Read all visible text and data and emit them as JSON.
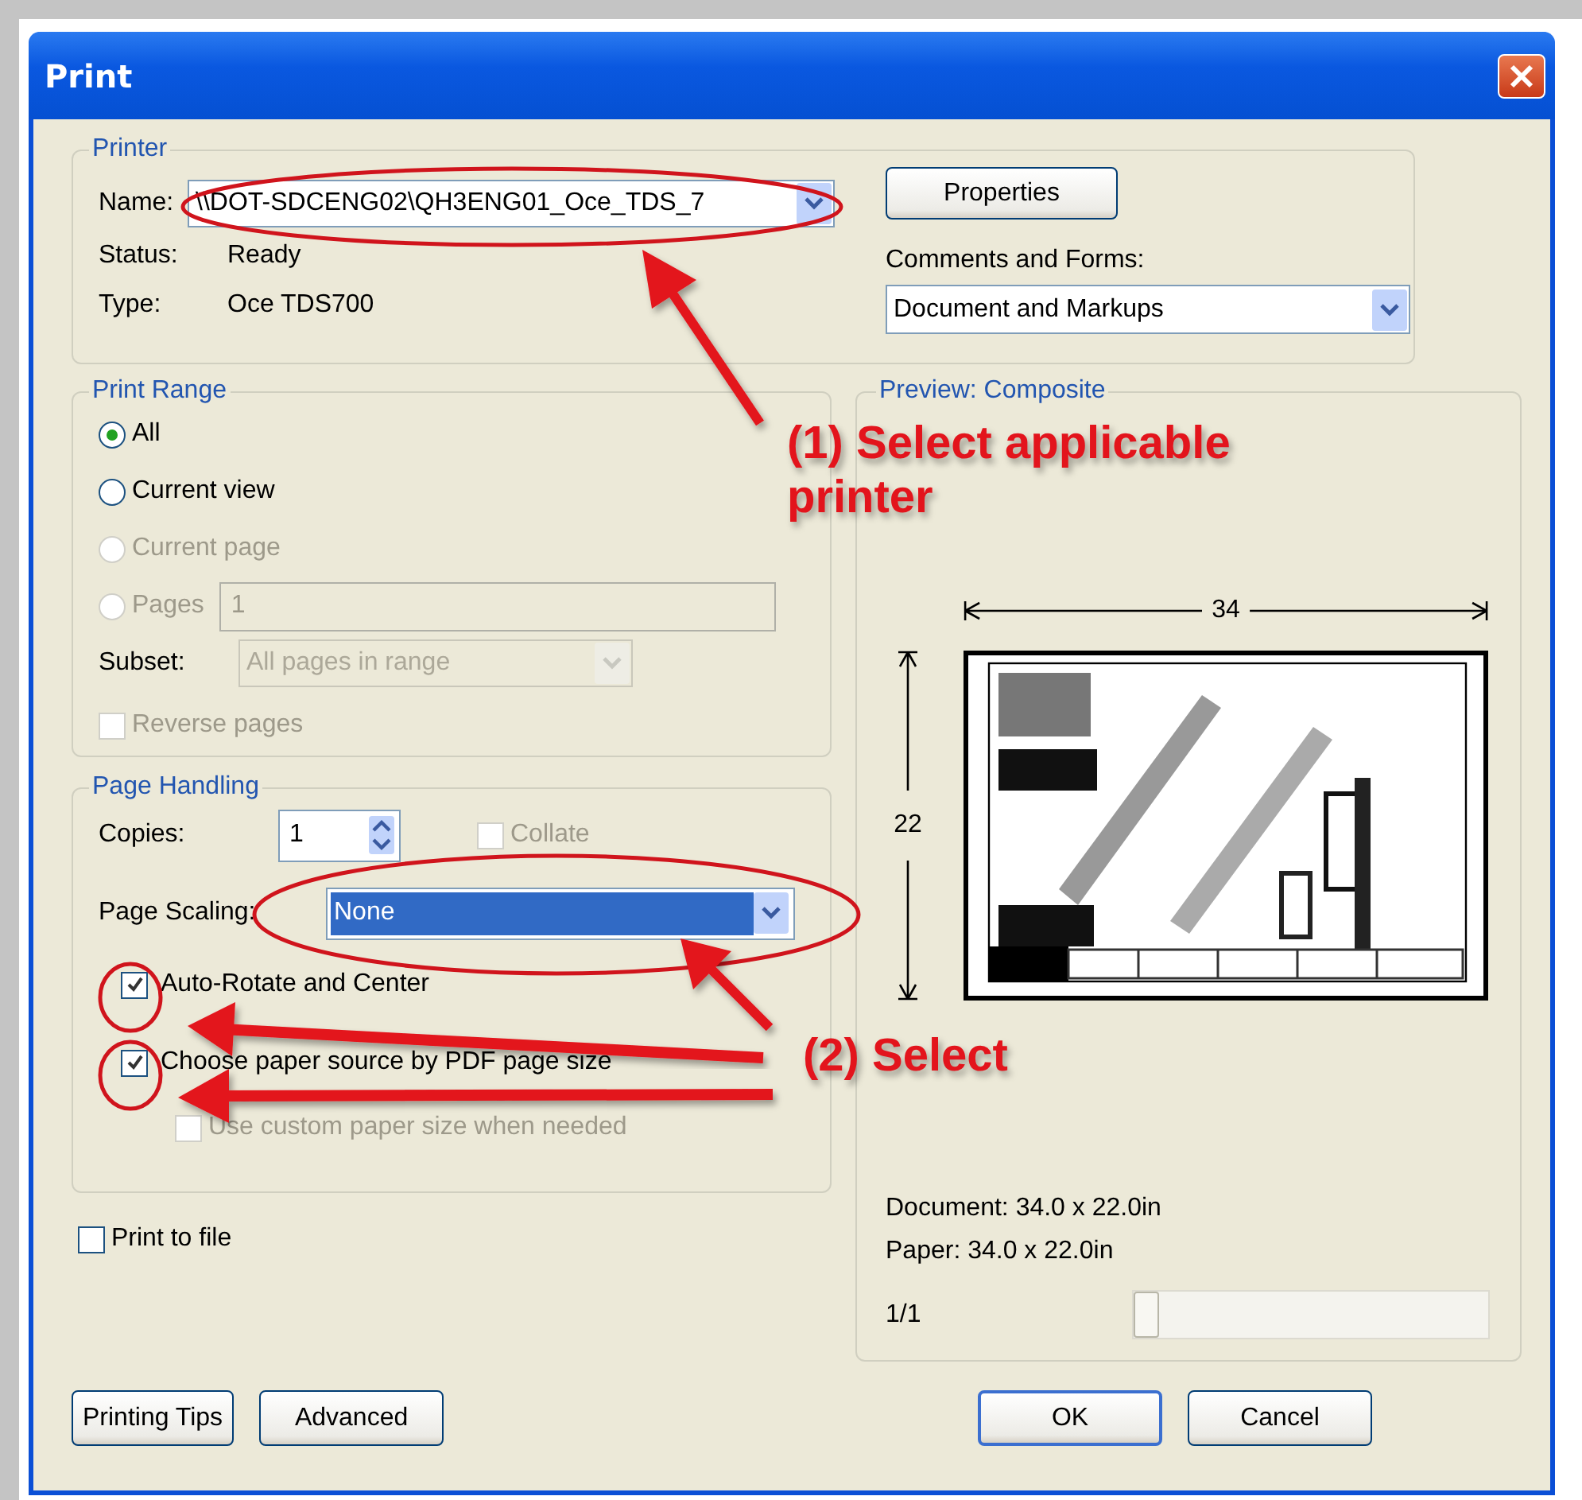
{
  "window": {
    "title": "Print"
  },
  "printer": {
    "title": "Printer",
    "name_label": "Name:",
    "name_value": "\\\\DOT-SDCENG02\\QH3ENG01_Oce_TDS_7",
    "properties_button": "Properties",
    "status_label": "Status:",
    "status_value": "Ready",
    "type_label": "Type:",
    "type_value": "Oce TDS700",
    "comments_label": "Comments and Forms:",
    "comments_value": "Document and Markups"
  },
  "print_range": {
    "title": "Print Range",
    "options": [
      {
        "label": "All",
        "selected": true,
        "disabled": false
      },
      {
        "label": "Current view",
        "selected": false,
        "disabled": false
      },
      {
        "label": "Current page",
        "selected": false,
        "disabled": true
      },
      {
        "label": "Pages",
        "selected": false,
        "disabled": true,
        "value": "1"
      }
    ],
    "subset_label": "Subset:",
    "subset_value": "All pages in range",
    "subset_disabled": true,
    "reverse_pages": {
      "label": "Reverse pages",
      "checked": false,
      "disabled": true
    }
  },
  "page_handling": {
    "title": "Page Handling",
    "copies_label": "Copies:",
    "copies_value": "1",
    "collate": {
      "label": "Collate",
      "checked": false,
      "disabled": true
    },
    "scaling_label": "Page Scaling:",
    "scaling_value": "None",
    "options": [
      {
        "label": "Auto-Rotate and Center",
        "checked": true,
        "disabled": false
      },
      {
        "label": "Choose paper source by PDF page size",
        "checked": true,
        "disabled": false,
        "children": [
          {
            "label": "Use custom paper size when needed",
            "checked": false,
            "disabled": true
          }
        ]
      }
    ]
  },
  "print_to_file": {
    "label": "Print to file",
    "checked": false
  },
  "preview": {
    "title": "Preview: Composite",
    "width_label": "34",
    "height_label": "22",
    "document": "Document: 34.0 x 22.0in",
    "paper": "Paper: 34.0 x 22.0in",
    "page": "1/1",
    "page_slider": {
      "level": 0
    }
  },
  "buttons_left": [
    "Printing Tips",
    "Advanced"
  ],
  "buttons_right": [
    {
      "label": "OK",
      "default": true
    },
    {
      "label": "Cancel",
      "default": false
    }
  ],
  "annotations": [
    {
      "text": "(1) Select applicable printer"
    },
    {
      "text": "(2) Select"
    }
  ]
}
